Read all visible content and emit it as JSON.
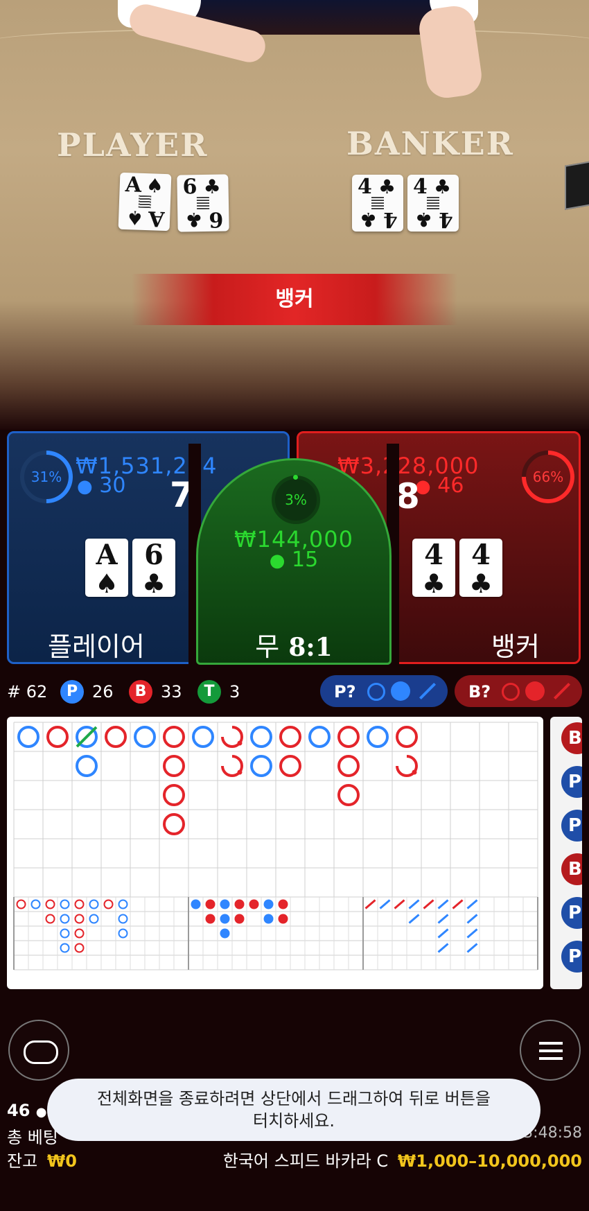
{
  "table": {
    "player_label": "PLAYER",
    "banker_label": "BANKER",
    "player_cards": [
      {
        "rank": "A",
        "suit": "♠"
      },
      {
        "rank": "6",
        "suit": "♣"
      }
    ],
    "banker_cards": [
      {
        "rank": "4",
        "suit": "♣"
      },
      {
        "rank": "4",
        "suit": "♣"
      }
    ],
    "result_banner": "뱅커"
  },
  "bets": {
    "player": {
      "percent": "31%",
      "percent_value": 0.31,
      "amount": "₩1,531,264",
      "count": "30",
      "score": "7",
      "label": "플레이어",
      "color": "#2f86ff",
      "cards": [
        {
          "rank": "A",
          "suit": "♠"
        },
        {
          "rank": "6",
          "suit": "♣"
        }
      ]
    },
    "tie": {
      "percent": "3%",
      "percent_value": 0.03,
      "amount": "₩144,000",
      "count": "15",
      "label_word": "무",
      "label_odds": "8:1",
      "color": "#2bd92f"
    },
    "banker": {
      "percent": "66%",
      "percent_value": 0.66,
      "amount": "₩3,228,000",
      "count": "46",
      "score": "8",
      "label": "뱅커",
      "color": "#ff2a2a",
      "cards": [
        {
          "rank": "4",
          "suit": "♣"
        },
        {
          "rank": "4",
          "suit": "♣"
        }
      ]
    }
  },
  "stats": {
    "round_prefix": "#",
    "round": "62",
    "player_letter": "P",
    "player_wins": "26",
    "banker_letter": "B",
    "banker_wins": "33",
    "tie_letter": "T",
    "ties": "3"
  },
  "predictions": {
    "player_label": "P?",
    "banker_label": "B?",
    "player_color": "#2f86ff",
    "banker_color": "#e4242a"
  },
  "roadmap": {
    "big_road": [
      {
        "col": 0,
        "row": 0,
        "c": "P"
      },
      {
        "col": 1,
        "row": 0,
        "c": "B"
      },
      {
        "col": 2,
        "row": 0,
        "c": "P",
        "tie": true
      },
      {
        "col": 2,
        "row": 1,
        "c": "P"
      },
      {
        "col": 3,
        "row": 0,
        "c": "B"
      },
      {
        "col": 4,
        "row": 0,
        "c": "P"
      },
      {
        "col": 5,
        "row": 0,
        "c": "B"
      },
      {
        "col": 5,
        "row": 1,
        "c": "B"
      },
      {
        "col": 5,
        "row": 2,
        "c": "B"
      },
      {
        "col": 5,
        "row": 3,
        "c": "B"
      },
      {
        "col": 6,
        "row": 0,
        "c": "P"
      },
      {
        "col": 7,
        "row": 0,
        "c": "B",
        "partial": true
      },
      {
        "col": 7,
        "row": 1,
        "c": "B",
        "partial": true
      },
      {
        "col": 8,
        "row": 0,
        "c": "P"
      },
      {
        "col": 8,
        "row": 1,
        "c": "P"
      },
      {
        "col": 9,
        "row": 0,
        "c": "B"
      },
      {
        "col": 9,
        "row": 1,
        "c": "B"
      },
      {
        "col": 10,
        "row": 0,
        "c": "P"
      },
      {
        "col": 11,
        "row": 0,
        "c": "B"
      },
      {
        "col": 11,
        "row": 1,
        "c": "B"
      },
      {
        "col": 11,
        "row": 2,
        "c": "B"
      },
      {
        "col": 12,
        "row": 0,
        "c": "P"
      },
      {
        "col": 13,
        "row": 0,
        "c": "B"
      },
      {
        "col": 13,
        "row": 1,
        "c": "B",
        "partial": true
      }
    ],
    "big_eye": [
      {
        "c": 0,
        "r": 0,
        "k": "B"
      },
      {
        "c": 1,
        "r": 0,
        "k": "P"
      },
      {
        "c": 2,
        "r": 0,
        "k": "B"
      },
      {
        "c": 2,
        "r": 1,
        "k": "B"
      },
      {
        "c": 3,
        "r": 0,
        "k": "P"
      },
      {
        "c": 3,
        "r": 1,
        "k": "P"
      },
      {
        "c": 3,
        "r": 2,
        "k": "P"
      },
      {
        "c": 3,
        "r": 3,
        "k": "P"
      },
      {
        "c": 4,
        "r": 0,
        "k": "B"
      },
      {
        "c": 4,
        "r": 1,
        "k": "B"
      },
      {
        "c": 4,
        "r": 2,
        "k": "B"
      },
      {
        "c": 4,
        "r": 3,
        "k": "B"
      },
      {
        "c": 5,
        "r": 0,
        "k": "P"
      },
      {
        "c": 5,
        "r": 1,
        "k": "P"
      },
      {
        "c": 6,
        "r": 0,
        "k": "B"
      },
      {
        "c": 7,
        "r": 0,
        "k": "P"
      },
      {
        "c": 7,
        "r": 1,
        "k": "P"
      },
      {
        "c": 7,
        "r": 2,
        "k": "P"
      }
    ],
    "small": [
      {
        "c": 0,
        "r": 0,
        "k": "P"
      },
      {
        "c": 1,
        "r": 0,
        "k": "B"
      },
      {
        "c": 1,
        "r": 1,
        "k": "B"
      },
      {
        "c": 2,
        "r": 0,
        "k": "P"
      },
      {
        "c": 2,
        "r": 1,
        "k": "P"
      },
      {
        "c": 2,
        "r": 2,
        "k": "P"
      },
      {
        "c": 3,
        "r": 0,
        "k": "B"
      },
      {
        "c": 3,
        "r": 1,
        "k": "B"
      },
      {
        "c": 4,
        "r": 0,
        "k": "B"
      },
      {
        "c": 5,
        "r": 0,
        "k": "P"
      },
      {
        "c": 5,
        "r": 1,
        "k": "P"
      },
      {
        "c": 6,
        "r": 0,
        "k": "B"
      },
      {
        "c": 6,
        "r": 1,
        "k": "B"
      }
    ],
    "cockroach": [
      {
        "c": 0,
        "r": 0,
        "k": "B"
      },
      {
        "c": 1,
        "r": 0,
        "k": "P"
      },
      {
        "c": 2,
        "r": 0,
        "k": "B"
      },
      {
        "c": 3,
        "r": 0,
        "k": "P"
      },
      {
        "c": 3,
        "r": 1,
        "k": "P"
      },
      {
        "c": 4,
        "r": 0,
        "k": "B"
      },
      {
        "c": 5,
        "r": 0,
        "k": "P"
      },
      {
        "c": 5,
        "r": 1,
        "k": "P"
      },
      {
        "c": 5,
        "r": 2,
        "k": "P"
      },
      {
        "c": 5,
        "r": 3,
        "k": "P"
      },
      {
        "c": 6,
        "r": 0,
        "k": "B"
      },
      {
        "c": 7,
        "r": 0,
        "k": "P"
      },
      {
        "c": 7,
        "r": 1,
        "k": "P"
      },
      {
        "c": 7,
        "r": 2,
        "k": "P"
      },
      {
        "c": 7,
        "r": 3,
        "k": "P"
      }
    ],
    "bead_side": [
      "B",
      "P",
      "P",
      "B",
      "P",
      "P"
    ]
  },
  "footer": {
    "players_online": "46",
    "total_bet_label": "총 베팅",
    "time": "13:48:58",
    "balance_label": "잔고",
    "balance_value": "₩0",
    "table_name": "한국어 스피드 바카라 C",
    "limits": "₩1,000–10,000,000",
    "toast": "전체화면을 종료하려면 상단에서 드래그하여 뒤로 버튼을\n터치하세요."
  },
  "icons": {
    "left_button": "chat-bubble-icon",
    "right_button": "hamburger-menu-icon",
    "person": "person-icon"
  }
}
